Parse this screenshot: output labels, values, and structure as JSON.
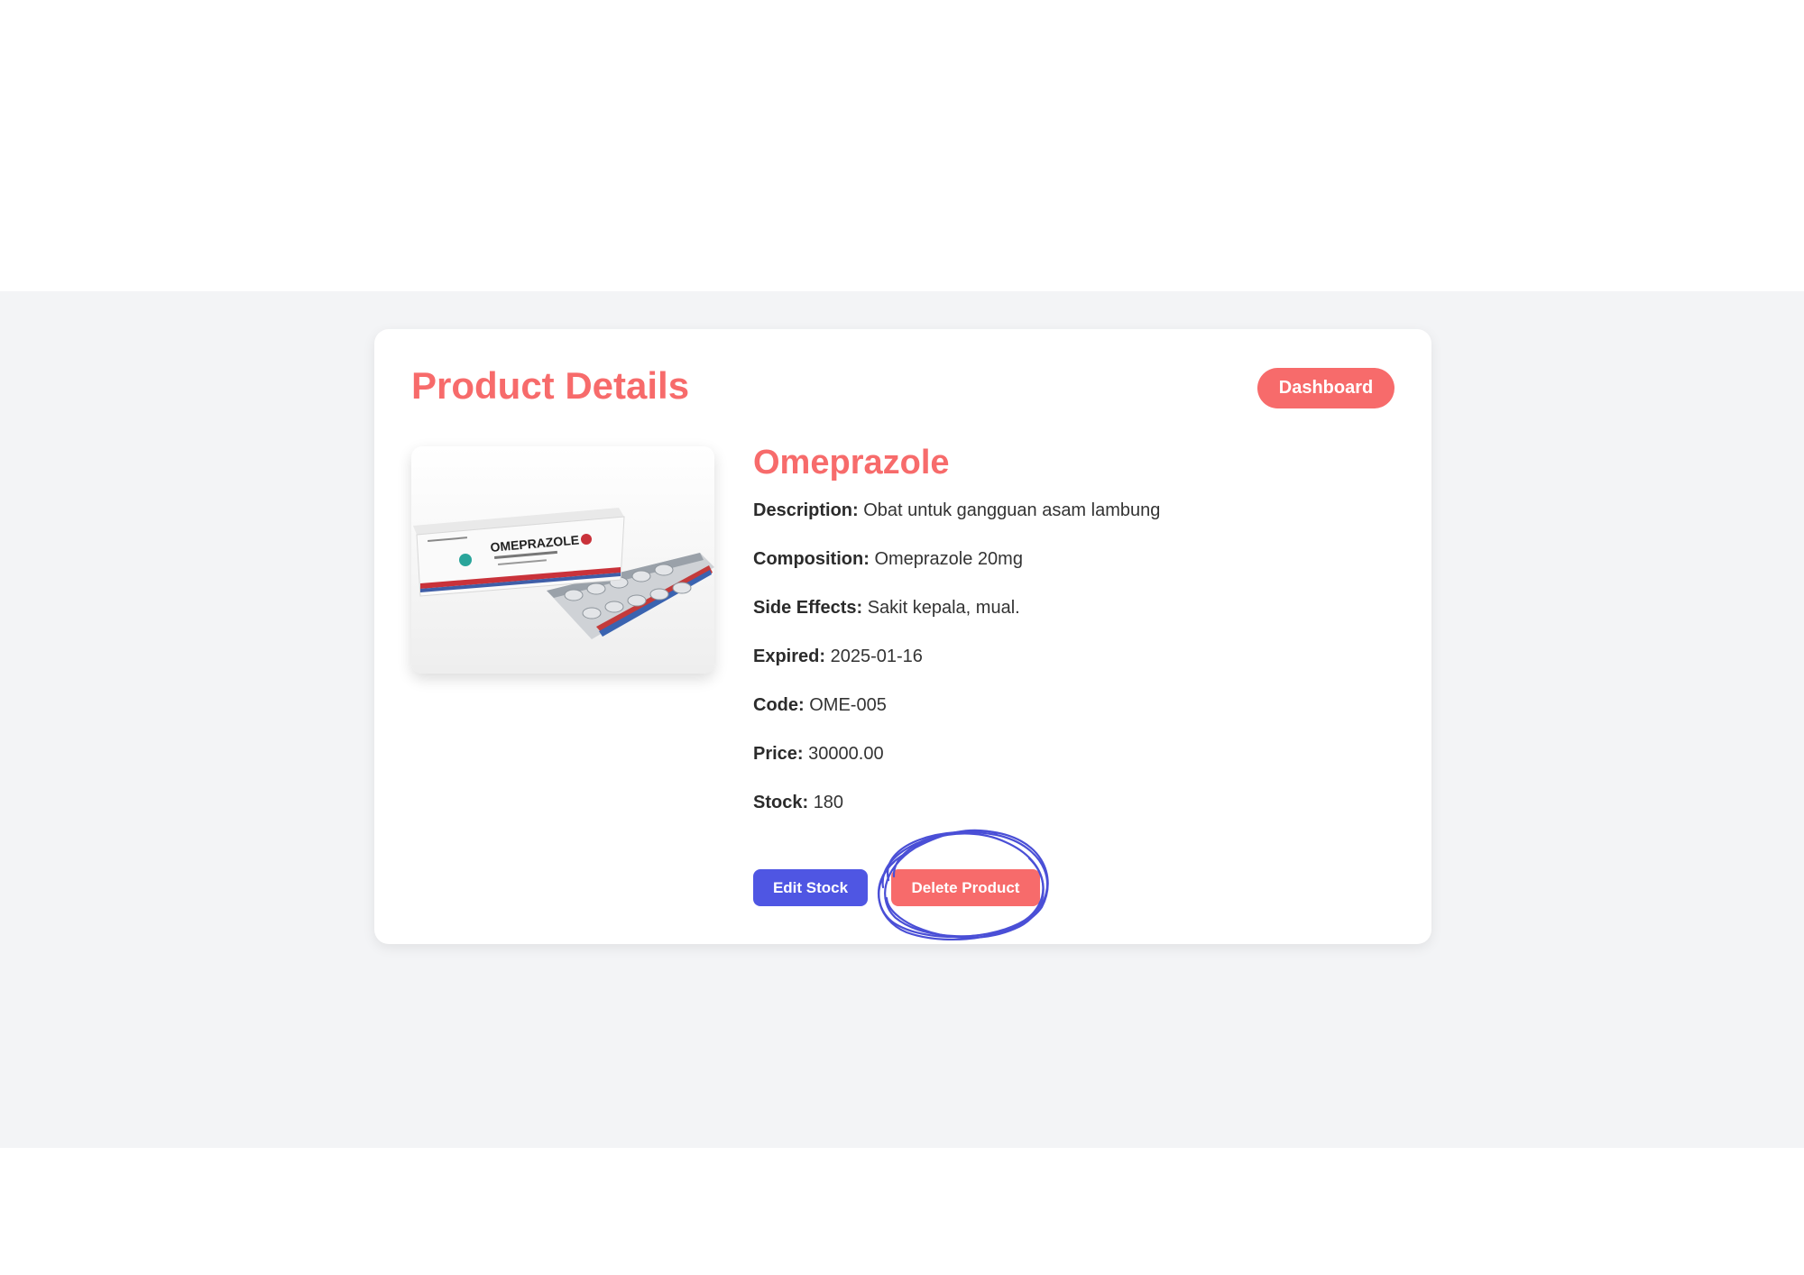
{
  "colors": {
    "accent": "#f76b6b",
    "edit_button": "#4f56e3",
    "annotation": "#4a4fd6",
    "background_band": "#f3f4f6"
  },
  "page": {
    "title": "Product Details"
  },
  "header": {
    "dashboard_label": "Dashboard"
  },
  "product": {
    "name": "Omeprazole",
    "image_icon": "medicine-box-image",
    "image_text": {
      "brand": "OMEPRAZOLE"
    },
    "fields": [
      {
        "label": "Description:",
        "value": "Obat untuk gangguan asam lambung"
      },
      {
        "label": "Composition:",
        "value": "Omeprazole 20mg"
      },
      {
        "label": "Side Effects:",
        "value": "Sakit kepala, mual."
      },
      {
        "label": "Expired:",
        "value": "2025-01-16"
      },
      {
        "label": "Code:",
        "value": "OME-005"
      },
      {
        "label": "Price:",
        "value": "30000.00"
      },
      {
        "label": "Stock:",
        "value": "180"
      }
    ]
  },
  "actions": {
    "edit_label": "Edit Stock",
    "delete_label": "Delete Product"
  }
}
